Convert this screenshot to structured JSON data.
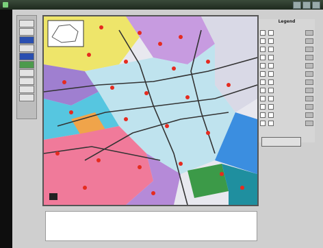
{
  "window": {
    "title": "",
    "controls": [
      "minimize",
      "maximize",
      "close"
    ]
  },
  "toolbar": {
    "tools": [
      "pan-tool",
      "zoom-in-tool",
      "zoom-out-tool",
      "identify-tool",
      "select-tool",
      "measure-tool",
      "layer-tool",
      "print-tool",
      "info-tool",
      "home-tool"
    ]
  },
  "map": {
    "caption": "",
    "colors": {
      "pink": "#f07a9a",
      "light_blue": "#bfe3ee",
      "cyan": "#56c6e0",
      "purple": "#b58ad8",
      "yellow": "#eee56a",
      "green": "#3c9a48",
      "orange": "#f0a44a",
      "road": "#333333",
      "marker": "#e52b1f"
    }
  },
  "legend": {
    "title": "Legend",
    "items": [
      {
        "label": "",
        "color": "#bfbfbf"
      },
      {
        "label": "",
        "color": "#bfbfbf"
      },
      {
        "label": "",
        "color": "#bfbfbf"
      },
      {
        "label": "",
        "color": "#bfbfbf"
      },
      {
        "label": "",
        "color": "#bfbfbf"
      },
      {
        "label": "",
        "color": "#bfbfbf"
      },
      {
        "label": "",
        "color": "#bfbfbf"
      },
      {
        "label": "",
        "color": "#bfbfbf"
      },
      {
        "label": "",
        "color": "#bfbfbf"
      },
      {
        "label": "",
        "color": "#bfbfbf"
      },
      {
        "label": "",
        "color": "#bfbfbf"
      },
      {
        "label": "",
        "color": "#bfbfbf"
      }
    ],
    "refresh_label": ""
  },
  "notes": {
    "text": ""
  }
}
